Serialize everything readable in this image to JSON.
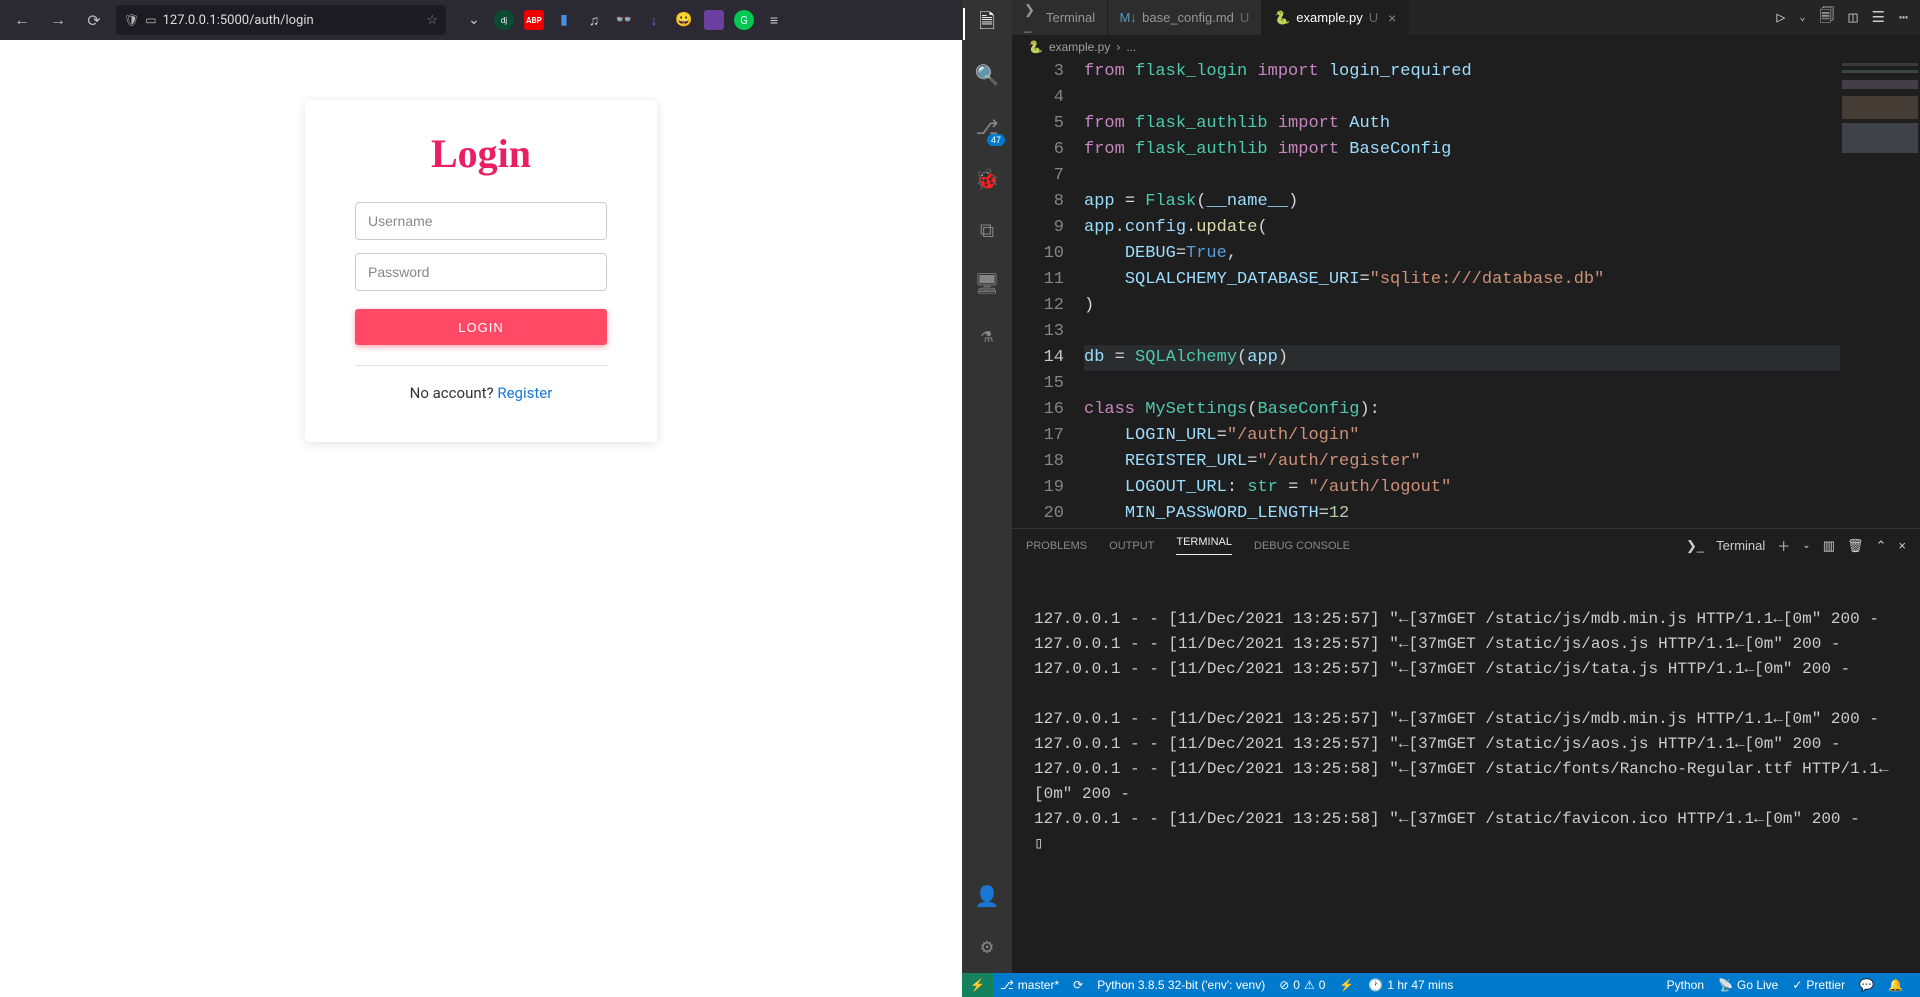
{
  "browser": {
    "url": "127.0.0.1:5000/auth/login",
    "login_title": "Login",
    "username_placeholder": "Username",
    "password_placeholder": "Password",
    "login_button": "LOGIN",
    "noacct_text": "No account? ",
    "register_link": "Register"
  },
  "vscode": {
    "tabs": [
      {
        "label": "Terminal",
        "icon": "terminal"
      },
      {
        "label": "base_config.md",
        "status": "U",
        "icon": "md"
      },
      {
        "label": "example.py",
        "status": "U",
        "icon": "py",
        "active": true
      }
    ],
    "breadcrumb": {
      "file": "example.py",
      "trail": "..."
    },
    "source_control_badge": "47",
    "editor_lines": [
      {
        "n": 3,
        "html": "<span class='kw'>from</span> <span class='mod'>flask_login</span> <span class='kw'>import</span> <span class='id'>login_required</span>"
      },
      {
        "n": 4,
        "html": ""
      },
      {
        "n": 5,
        "html": "<span class='kw'>from</span> <span class='mod'>flask_authlib</span> <span class='kw'>import</span> <span class='id'>Auth</span>"
      },
      {
        "n": 6,
        "html": "<span class='kw'>from</span> <span class='mod'>flask_authlib</span> <span class='kw'>import</span> <span class='id'>BaseConfig</span>"
      },
      {
        "n": 7,
        "html": ""
      },
      {
        "n": 8,
        "html": "<span class='var'>app</span> <span class='punc'>=</span> <span class='fn'>Flask</span><span class='punc'>(</span><span class='var'>__name__</span><span class='punc'>)</span>"
      },
      {
        "n": 9,
        "html": "<span class='var'>app</span><span class='punc'>.</span><span class='var'>config</span><span class='punc'>.</span><span class='dec'>update</span><span class='punc'>(</span>"
      },
      {
        "n": 10,
        "html": "    <span class='var'>DEBUG</span><span class='punc'>=</span><span class='bool'>True</span><span class='punc'>,</span>"
      },
      {
        "n": 11,
        "html": "    <span class='var'>SQLALCHEMY_DATABASE_URI</span><span class='punc'>=</span><span class='str'>\"sqlite:///database.db\"</span>"
      },
      {
        "n": 12,
        "html": "<span class='punc'>)</span>"
      },
      {
        "n": 13,
        "html": ""
      },
      {
        "n": 14,
        "html": "<span class='var'>db</span> <span class='punc'>=</span> <span class='fn'>SQLAlchemy</span><span class='punc'>(</span><span class='var'>app</span><span class='punc'>)</span>",
        "hl": true
      },
      {
        "n": 15,
        "html": ""
      },
      {
        "n": 16,
        "html": "<span class='kw'>class</span> <span class='fn'>MySettings</span><span class='punc'>(</span><span class='fn'>BaseConfig</span><span class='punc'>):</span>"
      },
      {
        "n": 17,
        "html": "    <span class='var'>LOGIN_URL</span><span class='punc'>=</span><span class='str'>\"/auth/login\"</span>"
      },
      {
        "n": 18,
        "html": "    <span class='var'>REGISTER_URL</span><span class='punc'>=</span><span class='str'>\"/auth/register\"</span>"
      },
      {
        "n": 19,
        "html": "    <span class='var'>LOGOUT_URL</span><span class='punc'>:</span> <span class='fn'>str</span> <span class='punc'>=</span> <span class='str'>\"/auth/logout\"</span>"
      },
      {
        "n": 20,
        "html": "    <span class='var'>MIN_PASSWORD_LENGTH</span><span class='punc'>=</span><span class='num'>12</span>"
      }
    ],
    "panel": {
      "tabs": [
        "PROBLEMS",
        "OUTPUT",
        "TERMINAL",
        "DEBUG CONSOLE"
      ],
      "active_tab": "TERMINAL",
      "dropdown": "Terminal",
      "log_lines": [
        "127.0.0.1 - - [11/Dec/2021 13:25:57] \"←[37mGET /static/js/mdb.min.js HTTP/1.1←[0m\" 200 -",
        "127.0.0.1 - - [11/Dec/2021 13:25:57] \"←[37mGET /static/js/aos.js HTTP/1.1←[0m\" 200 -",
        "127.0.0.1 - - [11/Dec/2021 13:25:57] \"←[37mGET /static/js/tata.js HTTP/1.1←[0m\" 200 -",
        "",
        "127.0.0.1 - - [11/Dec/2021 13:25:57] \"←[37mGET /static/js/mdb.min.js HTTP/1.1←[0m\" 200 -",
        "127.0.0.1 - - [11/Dec/2021 13:25:57] \"←[37mGET /static/js/aos.js HTTP/1.1←[0m\" 200 -",
        "127.0.0.1 - - [11/Dec/2021 13:25:58] \"←[37mGET /static/fonts/Rancho-Regular.ttf HTTP/1.1←[0m\" 200 -",
        "127.0.0.1 - - [11/Dec/2021 13:25:58] \"←[37mGET /static/favicon.ico HTTP/1.1←[0m\" 200 -",
        "▯"
      ]
    },
    "status": {
      "branch": "master*",
      "python": "Python 3.8.5 32-bit ('env': venv)",
      "errors": "0",
      "warnings": "0",
      "time": "1 hr 47 mins",
      "lang": "Python",
      "golive": "Go Live",
      "prettier": "Prettier"
    }
  }
}
